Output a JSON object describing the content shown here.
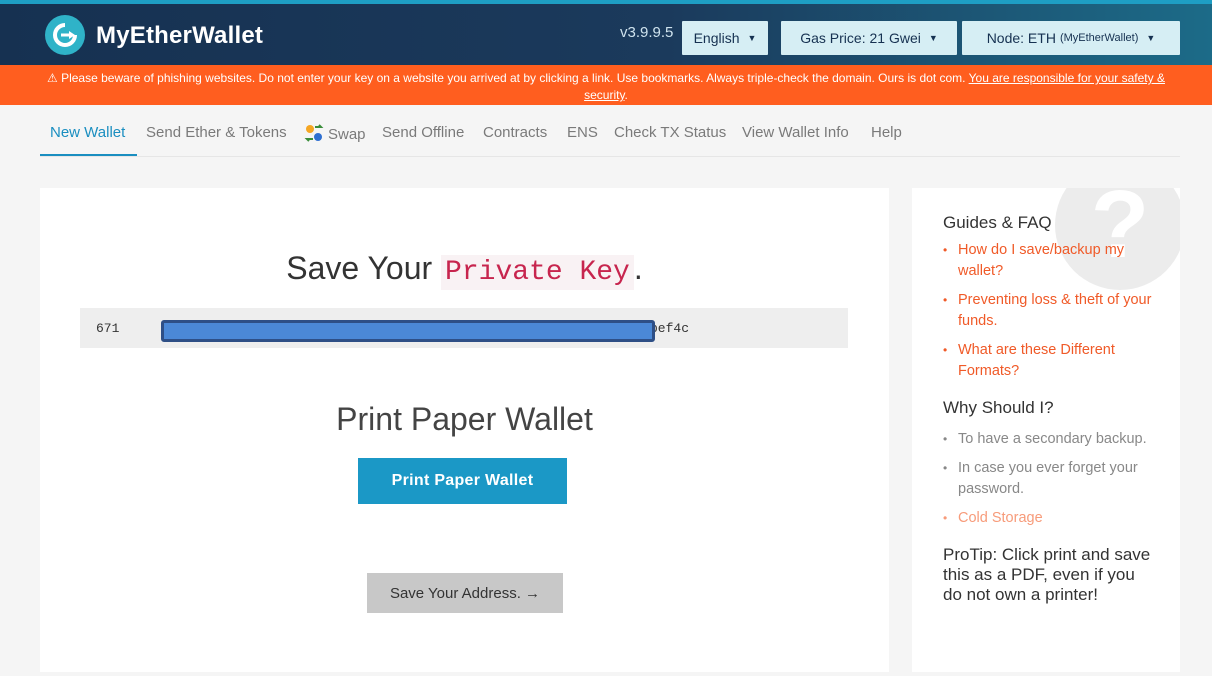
{
  "header": {
    "brand": "MyEtherWallet",
    "version": "v3.9.9.5",
    "language_label": "English",
    "gas_label": "Gas Price: 21 Gwei",
    "node_label": "Node: ETH",
    "node_sub": "(MyEtherWallet)",
    "logo_icon": "myetherwallet-logo-icon",
    "caret_icon": "caret-down-icon"
  },
  "banner": {
    "text": "⚠ Please beware of phishing websites. Do not enter your key on a website you arrived at by clicking a link. Use bookmarks. Always triple-check the domain. Ours is dot com. ",
    "link": "You are responsible for your safety & security",
    "end": "."
  },
  "nav": {
    "items": [
      "New Wallet",
      "Send Ether & Tokens",
      "Swap",
      "Send Offline",
      "Contracts",
      "ENS",
      "Check TX Status",
      "View Wallet Info",
      "Help"
    ],
    "active_index": 0
  },
  "main": {
    "save_prefix": "Save Your ",
    "save_code": "Private Key",
    "save_suffix": ".",
    "key_start": "671",
    "key_end": "bef4c",
    "print_title": "Print Paper Wallet",
    "print_button": "Print Paper Wallet",
    "address_button": "Save Your Address. →"
  },
  "sidebar": {
    "guides_title": "Guides & FAQ",
    "guides": [
      "How do I save/backup my wallet?",
      "Preventing loss & theft of your funds.",
      "What are these Different Formats?"
    ],
    "why_title": "Why Should I?",
    "why": [
      "To have a secondary backup.",
      "In case you ever forget your password.",
      "Cold Storage"
    ],
    "protip": "ProTip: Click print and save this as a PDF, even if you do not own a printer!",
    "question_mark": "?"
  },
  "colors": {
    "header_dark": "#163151",
    "accent": "#1b98c6",
    "warning": "#ff5e1f",
    "link": "#f05a28"
  }
}
